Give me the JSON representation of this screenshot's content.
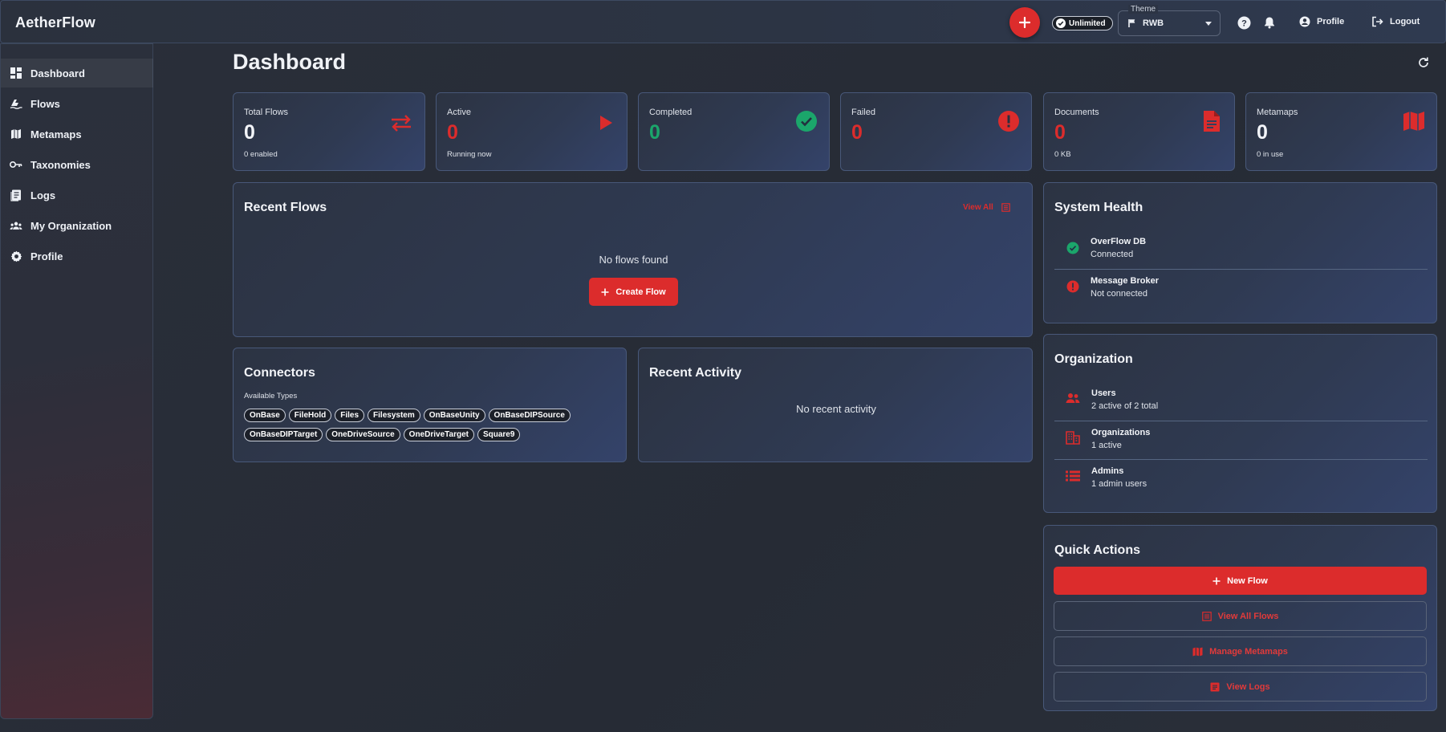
{
  "app": {
    "title": "AetherFlow",
    "unlimited_label": "Unlimited",
    "theme_label": "Theme",
    "theme_value": "RWB",
    "profile_label": "Profile",
    "logout_label": "Logout",
    "accent_color": "#dc2c2c",
    "success_color": "#1ba66b"
  },
  "sidebar": {
    "items": [
      {
        "label": "Dashboard",
        "icon": "dashboard-icon"
      },
      {
        "label": "Flows",
        "icon": "flows-icon"
      },
      {
        "label": "Metamaps",
        "icon": "map-icon"
      },
      {
        "label": "Taxonomies",
        "icon": "key-icon"
      },
      {
        "label": "Logs",
        "icon": "logs-icon"
      },
      {
        "label": "My Organization",
        "icon": "group-icon"
      },
      {
        "label": "Profile",
        "icon": "gear-icon"
      }
    ]
  },
  "page": {
    "title": "Dashboard"
  },
  "stats": [
    {
      "label": "Total Flows",
      "value": "0",
      "sub": "0 enabled",
      "icon": "swap-icon"
    },
    {
      "label": "Active",
      "value": "0",
      "sub": "Running now",
      "icon": "play-icon"
    },
    {
      "label": "Completed",
      "value": "0",
      "sub": "",
      "icon": "check-circle-icon"
    },
    {
      "label": "Failed",
      "value": "0",
      "sub": "",
      "icon": "error-icon"
    },
    {
      "label": "Documents",
      "value": "0",
      "sub": "0 KB",
      "icon": "document-icon"
    },
    {
      "label": "Metamaps",
      "value": "0",
      "sub": "0 in use",
      "icon": "map-icon"
    }
  ],
  "recent_flows": {
    "title": "Recent Flows",
    "view_all": "View All",
    "empty": "No flows found",
    "create_button": "Create Flow"
  },
  "connectors": {
    "title": "Connectors",
    "subtitle": "Available Types",
    "types": [
      "OnBase",
      "FileHold",
      "Files",
      "Filesystem",
      "OnBaseUnity",
      "OnBaseDIPSource",
      "OnBaseDIPTarget",
      "OneDriveSource",
      "OneDriveTarget",
      "Square9"
    ]
  },
  "recent_activity": {
    "title": "Recent Activity",
    "empty": "No recent activity"
  },
  "system_health": {
    "title": "System Health",
    "items": [
      {
        "name": "OverFlow DB",
        "status": "Connected",
        "state": "ok"
      },
      {
        "name": "Message Broker",
        "status": "Not connected",
        "state": "error"
      }
    ]
  },
  "organization": {
    "title": "Organization",
    "items": [
      {
        "name": "Users",
        "detail": "2 active of 2 total",
        "icon": "users-icon"
      },
      {
        "name": "Organizations",
        "detail": "1 active",
        "icon": "building-icon"
      },
      {
        "name": "Admins",
        "detail": "1 admin users",
        "icon": "admin-list-icon"
      }
    ]
  },
  "quick_actions": {
    "title": "Quick Actions",
    "new_flow": "New Flow",
    "view_all_flows": "View All Flows",
    "manage_metamaps": "Manage Metamaps",
    "view_logs": "View Logs"
  }
}
